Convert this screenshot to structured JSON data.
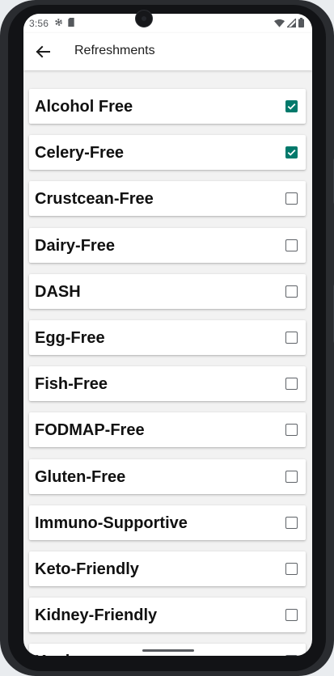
{
  "status_bar": {
    "time": "3:56",
    "left_icons": [
      "gear-icon",
      "sd-card-icon"
    ],
    "right_icons": [
      "wifi-icon",
      "signal-icon",
      "battery-icon"
    ]
  },
  "app_bar": {
    "back_icon": "arrow-left-icon",
    "title": "Refreshments"
  },
  "colors": {
    "checkbox_checked": "#00796b",
    "screen_background": "#f2f2f2"
  },
  "diet_items": [
    {
      "label": "Alcohol Free",
      "checked": true
    },
    {
      "label": "Celery-Free",
      "checked": true
    },
    {
      "label": "Crustcean-Free",
      "checked": false
    },
    {
      "label": "Dairy-Free",
      "checked": false
    },
    {
      "label": "DASH",
      "checked": false
    },
    {
      "label": "Egg-Free",
      "checked": false
    },
    {
      "label": "Fish-Free",
      "checked": false
    },
    {
      "label": "FODMAP-Free",
      "checked": false
    },
    {
      "label": "Gluten-Free",
      "checked": false
    },
    {
      "label": "Immuno-Supportive",
      "checked": false
    },
    {
      "label": "Keto-Friendly",
      "checked": false
    },
    {
      "label": "Kidney-Friendly",
      "checked": false
    },
    {
      "label": "Kosher",
      "checked": false
    }
  ]
}
